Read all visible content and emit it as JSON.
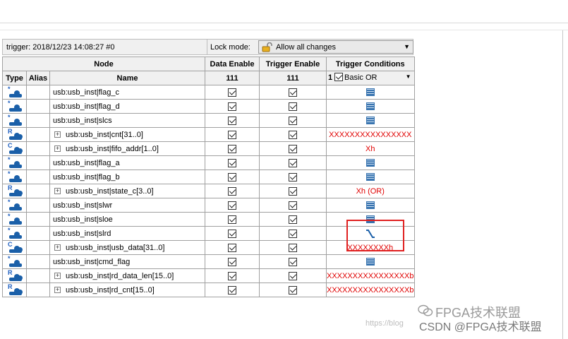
{
  "infobar": {
    "trigger_text": "trigger: 2018/12/23 14:08:27  #0",
    "lock_label": "Lock mode:",
    "lock_value": "Allow all changes"
  },
  "headers": {
    "node": "Node",
    "data_enable": "Data Enable",
    "trigger_enable": "Trigger Enable",
    "trigger_conditions": "Trigger Conditions",
    "type": "Type",
    "alias": "Alias",
    "name": "Name",
    "data_enable_count": "111",
    "trigger_enable_count": "111",
    "trigger_conditions_count": "1",
    "trigger_mode": "Basic OR"
  },
  "rows": [
    {
      "type": "input",
      "name": "usb:usb_inst|flag_c",
      "expand": false,
      "cond": "glyph",
      "cond_text": ""
    },
    {
      "type": "input",
      "name": "usb:usb_inst|flag_d",
      "expand": false,
      "cond": "glyph",
      "cond_text": ""
    },
    {
      "type": "input",
      "name": "usb:usb_inst|slcs",
      "expand": false,
      "cond": "glyph",
      "cond_text": ""
    },
    {
      "type": "reg",
      "name": "usb:usb_inst|cnt[31..0]",
      "expand": true,
      "cond": "text",
      "cond_text": "XXXXXXXXXXXXXXXX"
    },
    {
      "type": "comb",
      "name": "usb:usb_inst|fifo_addr[1..0]",
      "expand": true,
      "cond": "text",
      "cond_text": "Xh"
    },
    {
      "type": "input",
      "name": "usb:usb_inst|flag_a",
      "expand": false,
      "cond": "glyph",
      "cond_text": ""
    },
    {
      "type": "input",
      "name": "usb:usb_inst|flag_b",
      "expand": false,
      "cond": "glyph",
      "cond_text": ""
    },
    {
      "type": "reg",
      "name": "usb:usb_inst|state_c[3..0]",
      "expand": true,
      "cond": "text",
      "cond_text": "Xh (OR)"
    },
    {
      "type": "input",
      "name": "usb:usb_inst|slwr",
      "expand": false,
      "cond": "glyph",
      "cond_text": ""
    },
    {
      "type": "input",
      "name": "usb:usb_inst|sloe",
      "expand": false,
      "cond": "glyph",
      "cond_text": ""
    },
    {
      "type": "input",
      "name": "usb:usb_inst|slrd",
      "expand": false,
      "cond": "falling",
      "cond_text": ""
    },
    {
      "type": "comb",
      "name": "usb:usb_inst|usb_data[31..0]",
      "expand": true,
      "cond": "text",
      "cond_text": "XXXXXXXXh"
    },
    {
      "type": "input",
      "name": "usb:usb_inst|cmd_flag",
      "expand": false,
      "cond": "glyph",
      "cond_text": ""
    },
    {
      "type": "reg",
      "name": "usb:usb_inst|rd_data_len[15..0]",
      "expand": true,
      "cond": "text",
      "cond_text": "XXXXXXXXXXXXXXXXb"
    },
    {
      "type": "reg",
      "name": "usb:usb_inst|rd_cnt[15..0]",
      "expand": true,
      "cond": "text",
      "cond_text": "XXXXXXXXXXXXXXXXb"
    }
  ],
  "watermark": {
    "brand": "FPGA技术联盟",
    "url_faint": "https://blog",
    "csdn": "CSDN @FPGA技术联盟"
  },
  "colors": {
    "accent_red": "#e00000",
    "icon_blue": "#1a5fa8",
    "header_bg": "#f0f0f0"
  }
}
